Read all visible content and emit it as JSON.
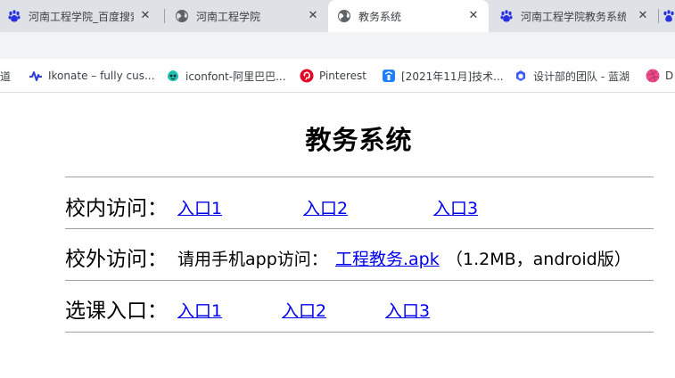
{
  "browser": {
    "tabs": [
      {
        "title": "河南工程学院_百度搜索",
        "icon": "baidu-paw-icon",
        "active": false
      },
      {
        "title": "河南工程学院",
        "icon": "globe-icon",
        "active": false
      },
      {
        "title": "教务系统",
        "icon": "globe-icon",
        "active": true
      },
      {
        "title": "河南工程学院教务系统",
        "icon": "baidu-paw-icon",
        "active": false
      }
    ],
    "bookmarks": [
      {
        "label": "道",
        "icon": "baidu-icon"
      },
      {
        "label": "Ikonate – fully cus...",
        "icon": "ikonate-icon"
      },
      {
        "label": "iconfont-阿里巴巴...",
        "icon": "iconfont-icon"
      },
      {
        "label": "Pinterest",
        "icon": "pinterest-icon"
      },
      {
        "label": "[2021年11月]技术...",
        "icon": "jishu-icon"
      },
      {
        "label": "设计部的团队 - 蓝湖",
        "icon": "lanhu-icon"
      },
      {
        "label": "D",
        "icon": "dribbble-icon"
      }
    ],
    "close_glyph": "✕",
    "colors": {
      "tabstrip": "#dee1e6",
      "active_tab": "#ffffff",
      "link": "#0000ee"
    }
  },
  "page": {
    "title": "教务系统",
    "campus_access": {
      "label": "校内访问：",
      "links": [
        "入口1",
        "入口2",
        "入口3"
      ]
    },
    "offcampus_access": {
      "label": "校外访问：",
      "text": "请用手机app访问：",
      "link": "工程教务.apk",
      "note": "（1.2MB，android版）"
    },
    "course_selection": {
      "label": "选课入口：",
      "links": [
        "入口1",
        "入口2",
        "入口3"
      ]
    }
  }
}
